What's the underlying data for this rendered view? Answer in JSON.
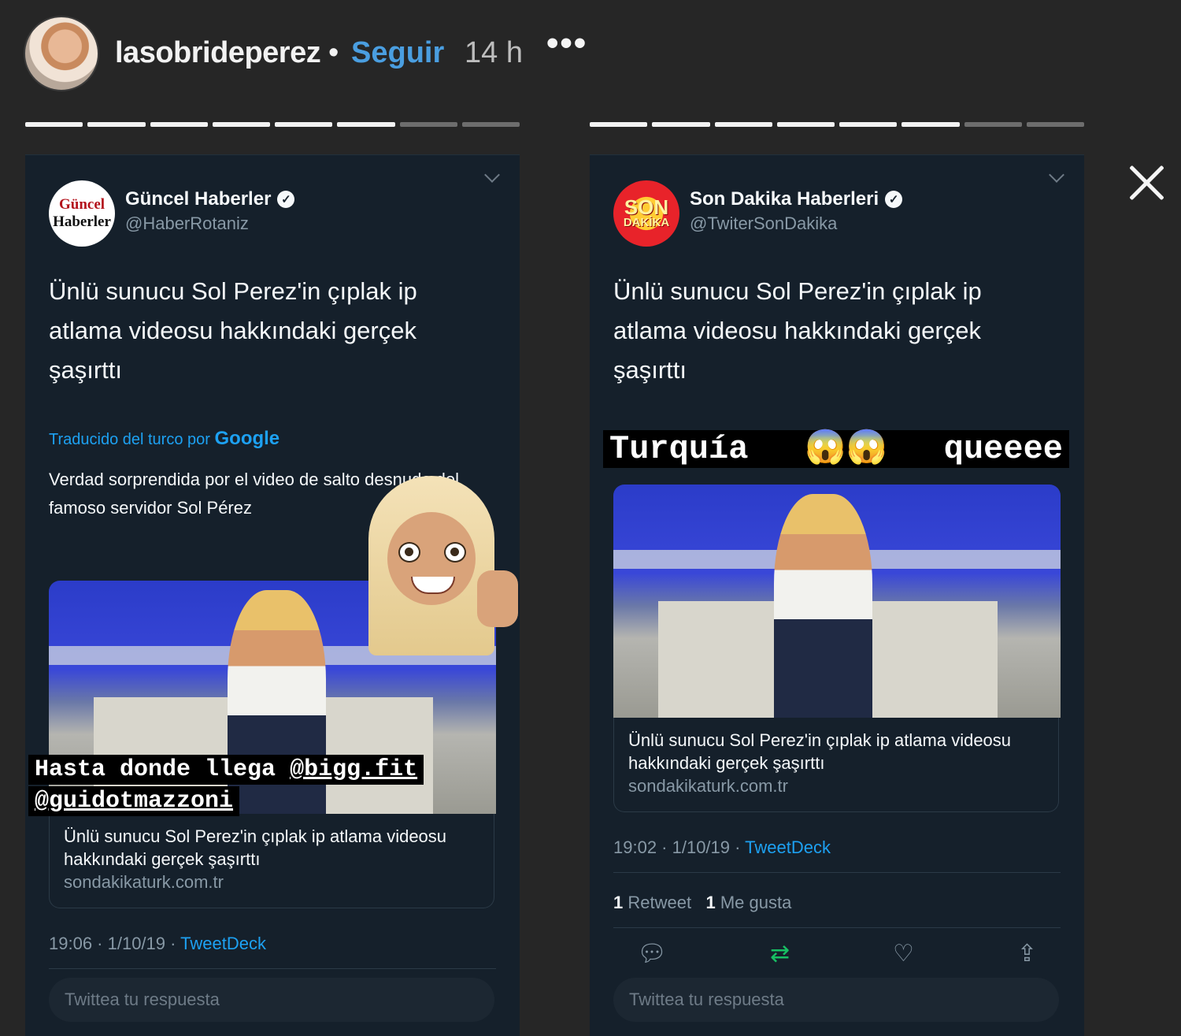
{
  "story": {
    "username": "lasobrideperez",
    "separator": "•",
    "follow_label": "Seguir",
    "time_ago": "14 h",
    "more_icon": "•••",
    "close_icon": "close-icon"
  },
  "progress": {
    "left": {
      "segments_total": 8,
      "segments_done": 6
    },
    "right": {
      "segments_total": 8,
      "segments_done": 6
    }
  },
  "tweet_left": {
    "avatar_lines": [
      "Güncel",
      "Haberler"
    ],
    "name": "Güncel Haberler",
    "handle": "@HaberRotaniz",
    "text": "Ünlü sunucu Sol Perez'in çıplak ip atlama videosu hakkındaki gerçek şaşırttı",
    "translated_prefix": "Traducido del turco por",
    "translated_brand": "Google",
    "translation": "Verdad sorprendida por el video de salto desnudo del famoso servidor Sol Pérez",
    "link_title": "Ünlü sunucu Sol Perez'in çıplak ip atlama videosu hakkındaki gerçek şaşırttı",
    "link_domain": "sondakikaturk.com.tr",
    "timestamp": "19:06 · 1/10/19 ·",
    "source": "TweetDeck",
    "reply_placeholder": "Twittea tu respuesta",
    "caption_line1_text": "Hasta donde llega ",
    "caption_line1_mention": "@bigg.fit",
    "caption_line2_mention": "@guidotmazzoni"
  },
  "tweet_right": {
    "avatar_lines": [
      "SON",
      "DAKİKA"
    ],
    "name": "Son Dakika Haberleri",
    "handle": "@TwiterSonDakika",
    "text": "Ünlü sunucu Sol Perez'in çıplak ip atlama videosu  hakkındaki gerçek şaşırttı",
    "caption_word1": "Turquía",
    "caption_emoji": "😱😱",
    "caption_word2": "queeee",
    "link_title": "Ünlü sunucu Sol Perez'in çıplak ip atlama videosu hakkındaki gerçek şaşırttı",
    "link_domain": "sondakikaturk.com.tr",
    "timestamp": "19:02 · 1/10/19 ·",
    "source": "TweetDeck",
    "retweet_count": "1",
    "retweet_label": "Retweet",
    "like_count": "1",
    "like_label": "Me gusta",
    "reply_placeholder": "Twittea tu respuesta",
    "icons": [
      "reply-icon",
      "retweet-icon",
      "like-icon",
      "share-icon"
    ]
  },
  "colors": {
    "background": "#262626",
    "tweet_bg": "#15202b",
    "link_blue": "#1da1f2",
    "follow_blue": "#4a9ee0",
    "retweet_green": "#17bf63"
  }
}
